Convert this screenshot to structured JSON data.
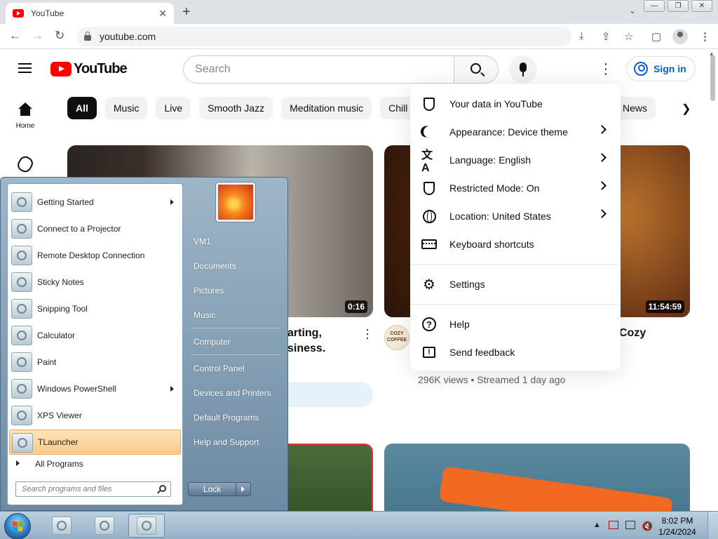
{
  "browser": {
    "tab_title": "YouTube",
    "tab_close": "✕",
    "new_tab": "+",
    "tab_search": "⌄",
    "url": "youtube.com",
    "back": "←",
    "forward": "→",
    "reload": "↻",
    "win_minimize": "—",
    "win_restore": "❐",
    "win_close": "✕"
  },
  "youtube": {
    "logo_text": "YouTube",
    "search_placeholder": "Search",
    "sign_in": "Sign in",
    "sidebar": {
      "home": "Home"
    },
    "chips": [
      "All",
      "Music",
      "Live",
      "Smooth Jazz",
      "Meditation music",
      "Chill"
    ],
    "chip_news": "News",
    "videos": [
      {
        "duration": "0:16",
        "title_line1": "arting,",
        "title_line2": "siness."
      },
      {
        "duration": "11:54:59",
        "title_fragment": "Cozy",
        "channel_badge": "COZY COFFEE",
        "meta": "296K views • Streamed 1 day ago"
      }
    ]
  },
  "settings_menu": {
    "items": [
      {
        "label": "Your data in YouTube",
        "icon": "shield-person-icon",
        "submenu": false
      },
      {
        "label": "Appearance: Device theme",
        "icon": "moon-icon",
        "submenu": true
      },
      {
        "label": "Language: English",
        "icon": "translate-icon",
        "submenu": true
      },
      {
        "label": "Restricted Mode: On",
        "icon": "restricted-shield-icon",
        "submenu": true
      },
      {
        "label": "Location: United States",
        "icon": "globe-icon",
        "submenu": true
      },
      {
        "label": "Keyboard shortcuts",
        "icon": "keyboard-icon",
        "submenu": false
      }
    ],
    "settings": "Settings",
    "help": "Help",
    "send_feedback": "Send feedback"
  },
  "start_menu": {
    "programs": [
      {
        "label": "Getting Started",
        "submenu": true
      },
      {
        "label": "Connect to a Projector",
        "submenu": false
      },
      {
        "label": "Remote Desktop Connection",
        "submenu": false
      },
      {
        "label": "Sticky Notes",
        "submenu": false
      },
      {
        "label": "Snipping Tool",
        "submenu": false
      },
      {
        "label": "Calculator",
        "submenu": false
      },
      {
        "label": "Paint",
        "submenu": false
      },
      {
        "label": "Windows PowerShell",
        "submenu": true
      },
      {
        "label": "XPS Viewer",
        "submenu": false
      },
      {
        "label": "TLauncher",
        "submenu": false,
        "highlighted": true
      }
    ],
    "all_programs": "All Programs",
    "search_placeholder": "Search programs and files",
    "right_links": [
      "VM1",
      "Documents",
      "Pictures",
      "Music",
      "Computer",
      "Control Panel",
      "Devices and Printers",
      "Default Programs",
      "Help and Support"
    ],
    "lock": "Lock"
  },
  "taskbar": {
    "time": "8:02 PM",
    "date": "1/24/2024",
    "tray_up": "▲"
  }
}
